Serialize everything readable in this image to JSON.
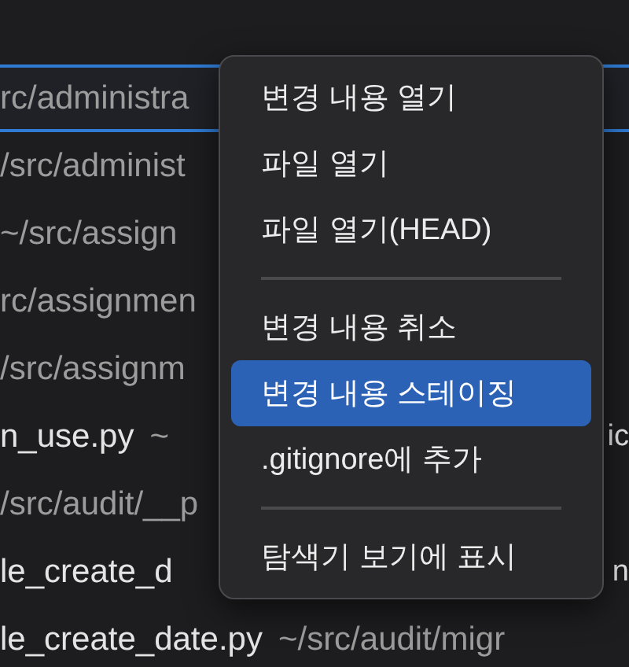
{
  "file_list": {
    "rows": [
      {
        "path": "rc/administra",
        "selected": true
      },
      {
        "path": "/src/administ",
        "selected": false
      },
      {
        "path": "~/src/assign",
        "selected": false
      },
      {
        "path": "rc/assignmen",
        "selected": false
      },
      {
        "path": "/src/assignm",
        "selected": false
      },
      {
        "name": "n_use.py",
        "path": "~",
        "right": "ic",
        "selected": false
      },
      {
        "path": "/src/audit/__p",
        "selected": false
      },
      {
        "name": "le_create_d",
        "right": "n",
        "selected": false
      },
      {
        "name": "le_create_date.py",
        "path": "~/src/audit/migr",
        "selected": false
      }
    ]
  },
  "context_menu": {
    "items": [
      {
        "kind": "item",
        "label": "변경 내용 열기",
        "selected": false
      },
      {
        "kind": "item",
        "label": "파일 열기",
        "selected": false
      },
      {
        "kind": "item",
        "label": "파일 열기(HEAD)",
        "selected": false
      },
      {
        "kind": "separator"
      },
      {
        "kind": "item",
        "label": "변경 내용 취소",
        "selected": false
      },
      {
        "kind": "item",
        "label": "변경 내용 스테이징",
        "selected": true
      },
      {
        "kind": "item",
        "label": ".gitignore에 추가",
        "selected": false
      },
      {
        "kind": "separator"
      },
      {
        "kind": "item",
        "label": "탐색기 보기에 표시",
        "selected": false
      }
    ]
  }
}
